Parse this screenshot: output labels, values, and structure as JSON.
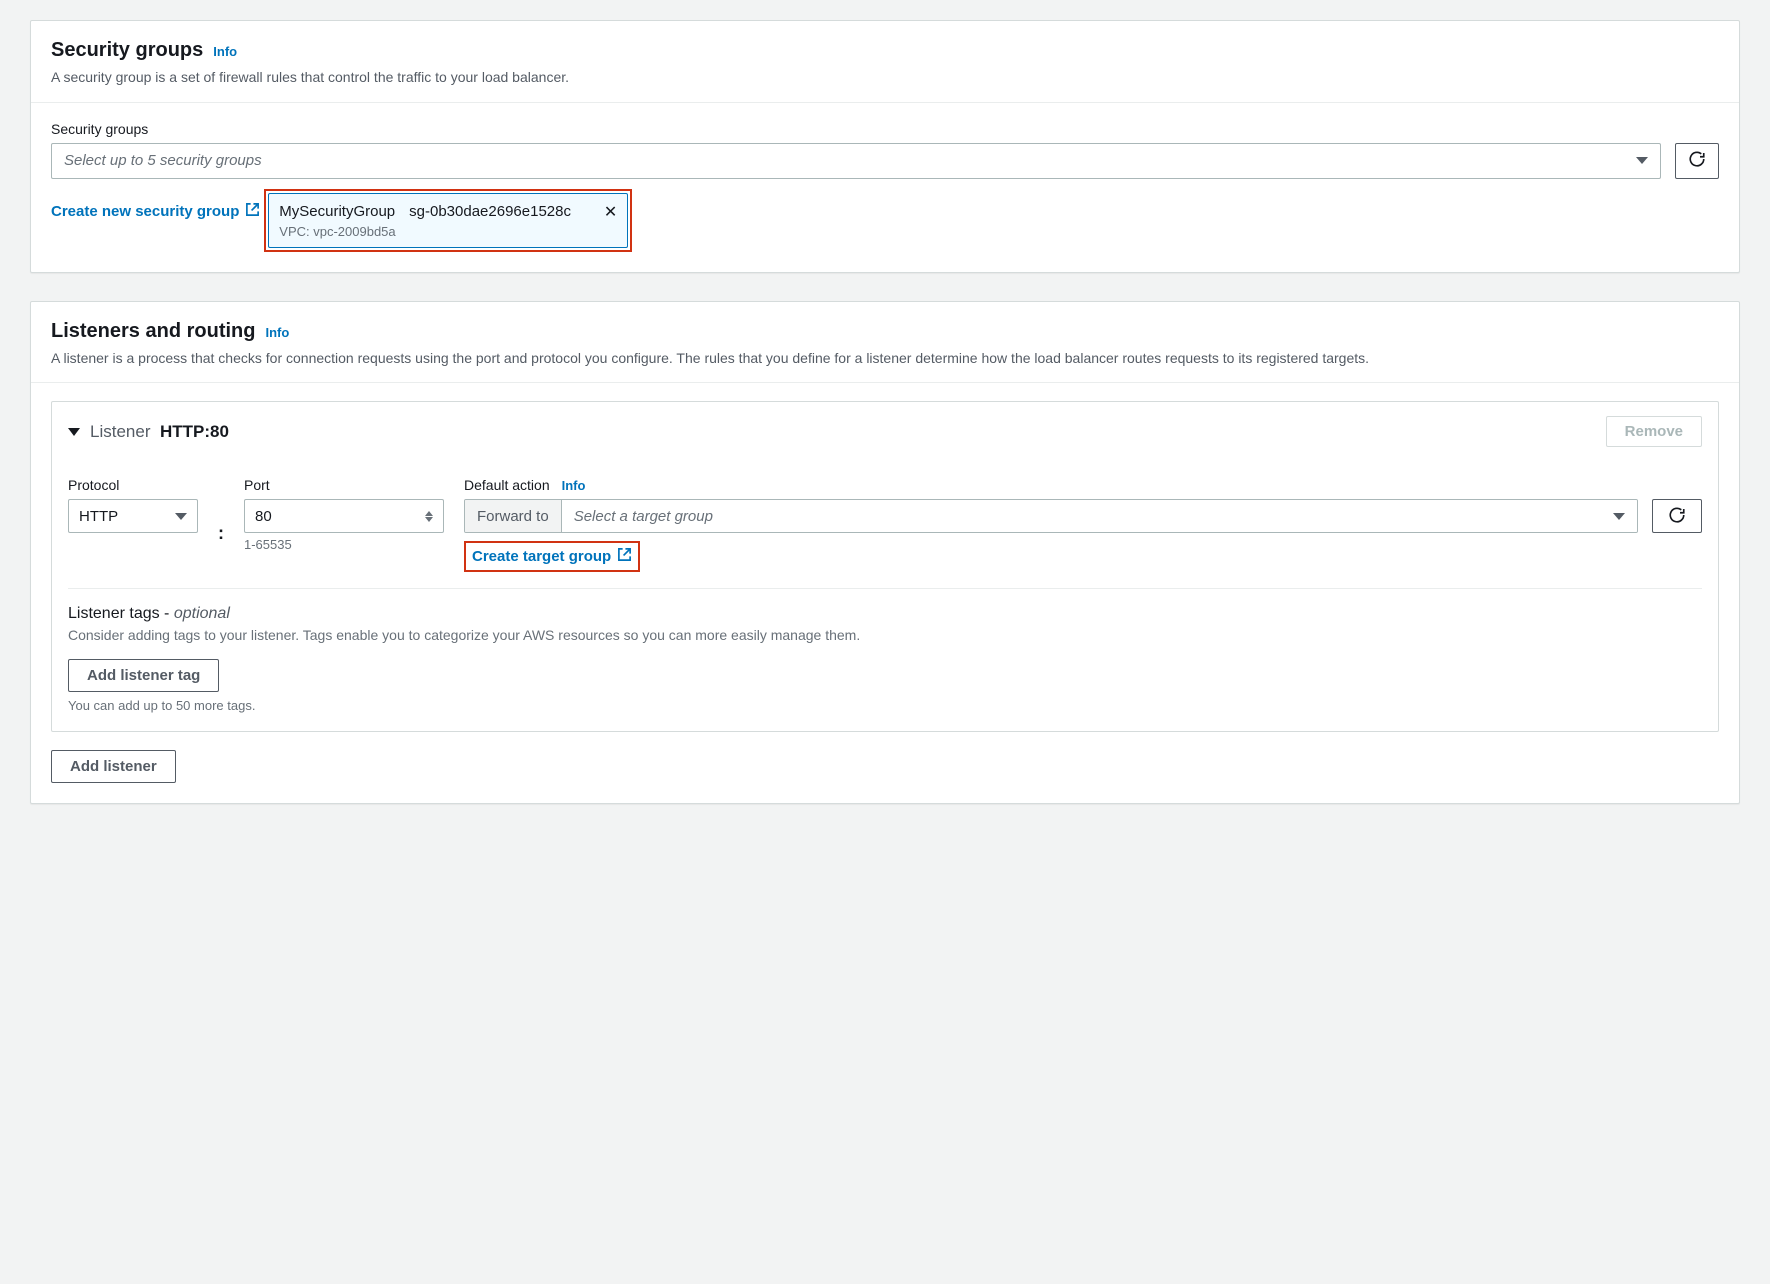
{
  "info_label": "Info",
  "security_groups": {
    "title": "Security groups",
    "description": "A security group is a set of firewall rules that control the traffic to your load balancer.",
    "field_label": "Security groups",
    "select_placeholder": "Select up to 5 security groups",
    "create_link": "Create new security group",
    "chip": {
      "name": "MySecurityGroup",
      "id": "sg-0b30dae2696e1528c",
      "vpc": "VPC: vpc-2009bd5a"
    }
  },
  "listeners": {
    "title": "Listeners and routing",
    "description": "A listener is a process that checks for connection requests using the port and protocol you configure. The rules that you define for a listener determine how the load balancer routes requests to its registered targets.",
    "listener": {
      "label": "Listener",
      "protocol_port": "HTTP:80",
      "remove_label": "Remove",
      "protocol_label": "Protocol",
      "protocol_value": "HTTP",
      "port_label": "Port",
      "port_value": "80",
      "port_hint": "1-65535",
      "default_action_label": "Default action",
      "forward_label": "Forward to",
      "target_placeholder": "Select a target group",
      "create_target_group": "Create target group",
      "tags_title": "Listener tags - ",
      "tags_optional": "optional",
      "tags_desc": "Consider adding tags to your listener. Tags enable you to categorize your AWS resources so you can more easily manage them.",
      "add_tag_btn": "Add listener tag",
      "tags_hint": "You can add up to 50 more tags."
    },
    "add_listener_btn": "Add listener"
  }
}
